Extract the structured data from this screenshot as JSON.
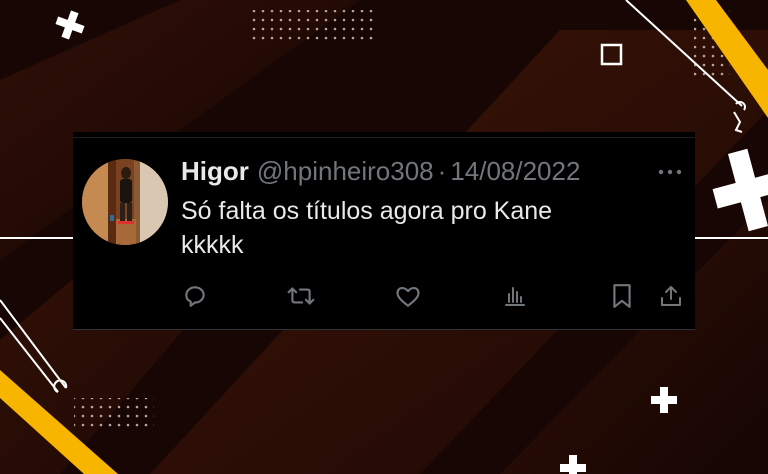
{
  "tweet": {
    "display_name": "Higor",
    "handle": "@hpinheiro308",
    "separator": "·",
    "date": "14/08/2022",
    "text": "Só falta os títulos agora pro Kane\nkkkkk"
  },
  "icons": {
    "more": "more-horizontal-icon",
    "reply": "reply-icon",
    "retweet": "retweet-icon",
    "like": "heart-icon",
    "views": "views-bar-chart-icon",
    "bookmark": "bookmark-icon",
    "share": "share-icon"
  },
  "colors": {
    "background": "#1a0704",
    "card": "#000000",
    "accent_yellow": "#f7b500",
    "text_primary": "#e7e9ea",
    "text_secondary": "#71767b"
  }
}
